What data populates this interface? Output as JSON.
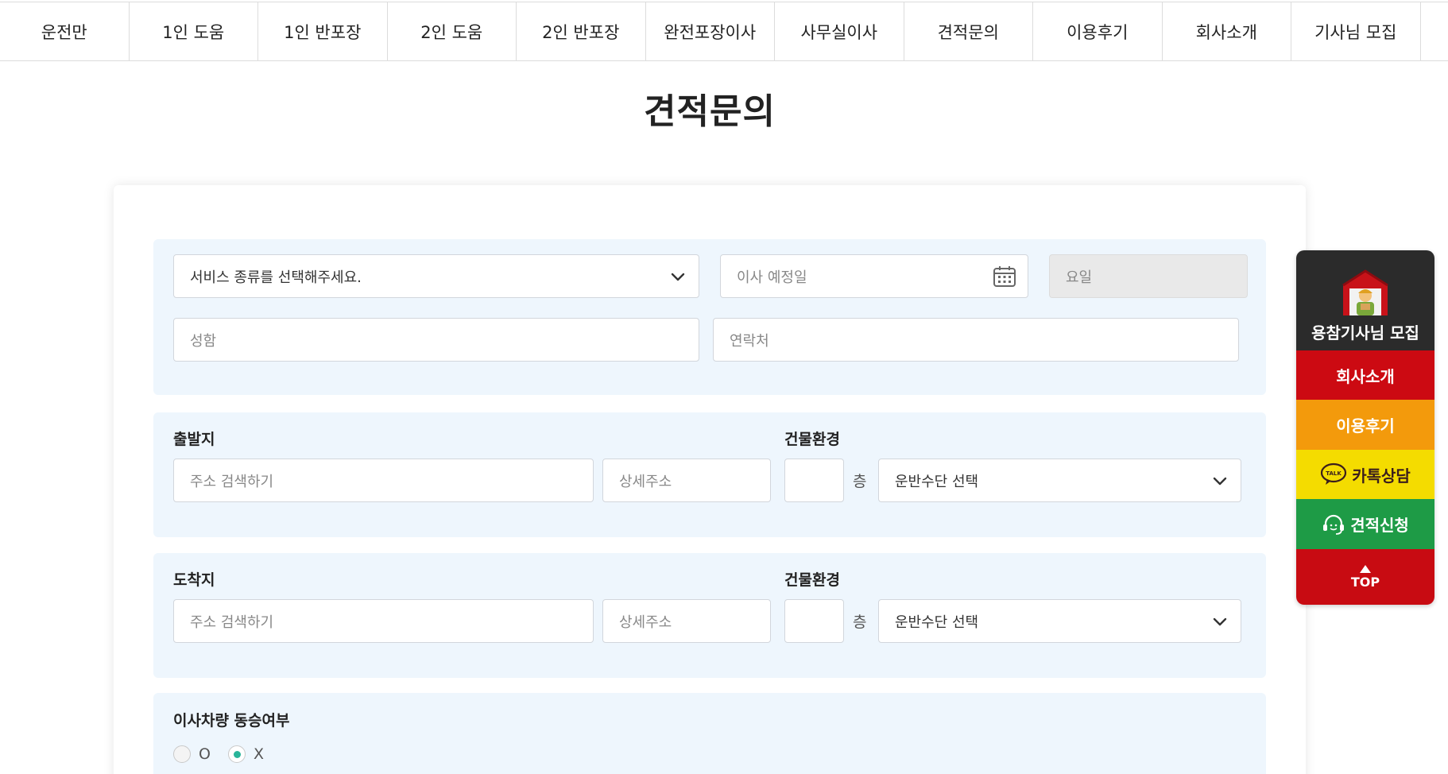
{
  "nav": {
    "items": [
      "운전만",
      "1인 도움",
      "1인 반포장",
      "2인 도움",
      "2인 반포장",
      "완전포장이사",
      "사무실이사",
      "견적문의",
      "이용후기",
      "회사소개",
      "기사님 모집"
    ]
  },
  "page": {
    "title": "견적문의"
  },
  "form": {
    "service_type": {
      "value": "서비스 종류를 선택해주세요."
    },
    "move_date": {
      "placeholder": "이사 예정일"
    },
    "weekday": {
      "placeholder": "요일"
    },
    "name": {
      "placeholder": "성함"
    },
    "phone": {
      "placeholder": "연락처"
    },
    "departure": {
      "label": "출발지",
      "building_label": "건물환경",
      "address_placeholder": "주소 검색하기",
      "detail_placeholder": "상세주소",
      "floor_unit": "층",
      "transport_value": "운반수단 선택"
    },
    "arrival": {
      "label": "도착지",
      "building_label": "건물환경",
      "address_placeholder": "주소 검색하기",
      "detail_placeholder": "상세주소",
      "floor_unit": "층",
      "transport_value": "운반수단 선택"
    },
    "ride_along": {
      "label": "이사차량 동승여부",
      "options": [
        "O",
        "X"
      ],
      "selected": "X"
    }
  },
  "side_menu": {
    "recruit": "용참기사님 모집",
    "company": "회사소개",
    "review": "이용후기",
    "kakao": "카톡상담",
    "kakao_badge": "TALK",
    "estimate": "견적신청",
    "top": "TOP"
  },
  "colors": {
    "panel_bg": "#eef6fd",
    "radio_accent": "#29b59a",
    "side_recruit": "#2b2b2b",
    "side_company": "#cc0a12",
    "side_review": "#f39a0c",
    "side_kakao": "#f4dc00",
    "side_estimate": "#1e9b46",
    "side_top": "#c80b12"
  },
  "icons": {
    "select_arrow": "chevron-down-icon",
    "date": "calendar-icon",
    "recruit": "mover-mascot-icon",
    "kakao": "kakao-talk-icon",
    "estimate": "headset-icon",
    "top": "arrow-up-icon"
  }
}
